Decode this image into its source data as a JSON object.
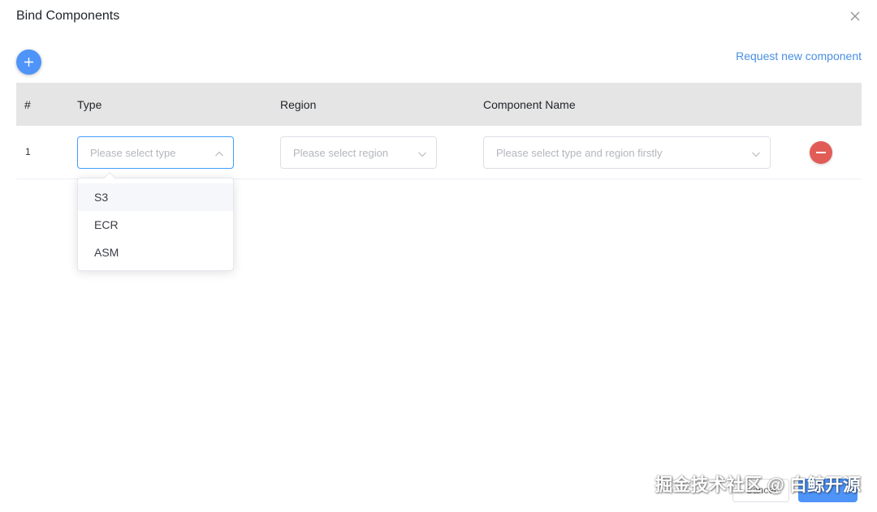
{
  "dialog": {
    "title": "Bind Components",
    "close_icon": "close-icon",
    "add_icon": "plus-icon",
    "request_link": "Request new component"
  },
  "table": {
    "headers": {
      "num": "#",
      "type": "Type",
      "region": "Region",
      "name": "Component Name"
    },
    "rows": [
      {
        "num": "1",
        "type_placeholder": "Please select type",
        "region_placeholder": "Please select region",
        "name_placeholder": "Please select type and region firstly",
        "remove_icon": "minus-icon"
      }
    ]
  },
  "type_dropdown": {
    "open": true,
    "options": [
      "S3",
      "ECR",
      "ASM"
    ]
  },
  "footer": {
    "cancel_label": "Cancel",
    "confirm_label": ""
  },
  "watermark": "掘金技术社区 @ 白鲸开源",
  "colors": {
    "primary": "#4f94f8",
    "link": "#4a90e2",
    "danger": "#e25c57",
    "header_bg": "#e5e5e5",
    "focus_border": "#409eff"
  }
}
